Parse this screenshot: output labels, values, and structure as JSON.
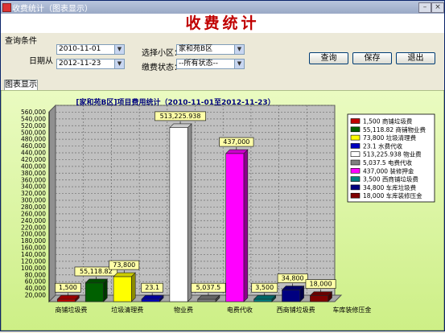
{
  "window": {
    "title": "收费统计（图表显示）"
  },
  "heading": "收费统计",
  "query": {
    "group_label": "查询条件",
    "date_label": "日期从",
    "date_from": "2010-11-01",
    "date_to": "2012-11-23",
    "community_label": "选择小区：",
    "community_value": "家和苑B区",
    "status_label": "缴费状态：",
    "status_value": "--所有状态--",
    "btn_query": "查询",
    "btn_save": "保存",
    "btn_exit": "退出"
  },
  "tab": {
    "label": "图表显示"
  },
  "colors": {
    "plot_bg": "#c0c0c0",
    "outer_bg": "#dff7a8",
    "title_color": "#000080"
  },
  "chart_data": {
    "type": "bar",
    "title": "[家和苑B区]项目费用统计（2010-11-01至2012-11-23）",
    "ylim": [
      0,
      560000
    ],
    "yticks": [
      "20,000",
      "40,000",
      "60,000",
      "80,000",
      "100,000",
      "120,000",
      "140,000",
      "160,000",
      "180,000",
      "200,000",
      "220,000",
      "240,000",
      "260,000",
      "280,000",
      "300,000",
      "320,000",
      "340,000",
      "360,000",
      "380,000",
      "400,000",
      "420,000",
      "440,000",
      "460,000",
      "480,000",
      "500,000",
      "520,000",
      "540,000",
      "560,000"
    ],
    "xlabels": [
      "商铺垃圾费",
      "垃圾清理费",
      "物业费",
      "电费代收",
      "西商铺垃圾费",
      "车库装修压金"
    ],
    "grid": true,
    "legend_position": "right",
    "series": [
      {
        "name": "商铺垃圾费",
        "value": 1500,
        "label": "1,500",
        "color": "#c00000"
      },
      {
        "name": "商铺物业费",
        "value": 55118.82,
        "label": "55,118.82",
        "color": "#006000"
      },
      {
        "name": "垃圾清理费",
        "value": 73800,
        "label": "73,800",
        "color": "#ffff00"
      },
      {
        "name": "水费代收",
        "value": 23.1,
        "label": "23.1",
        "color": "#0000c0"
      },
      {
        "name": "物业费",
        "value": 513225.938,
        "label": "513,225.938",
        "color": "#ffffff"
      },
      {
        "name": "电费代收",
        "value": 5037.5,
        "label": "5,037.5",
        "color": "#808080"
      },
      {
        "name": "装修押金",
        "value": 437000,
        "label": "437,000",
        "color": "#ff00ff"
      },
      {
        "name": "西商铺垃圾费",
        "value": 3500,
        "label": "3,500",
        "color": "#008080"
      },
      {
        "name": "车库垃圾费",
        "value": 34800,
        "label": "34,800",
        "color": "#000080"
      },
      {
        "name": "车库装修压金",
        "value": 18000,
        "label": "18,000",
        "color": "#800000"
      }
    ],
    "legend": [
      "1,500 商铺垃圾费",
      "55,118.82 商铺物业费",
      "73,800 垃圾清理费",
      "23.1 水费代收",
      "513,225.938 物业费",
      "5,037.5 电费代收",
      "437,000 装修押金",
      "3,500 西商铺垃圾费",
      "34,800 车库垃圾费",
      "18,000 车库装修压金"
    ]
  }
}
